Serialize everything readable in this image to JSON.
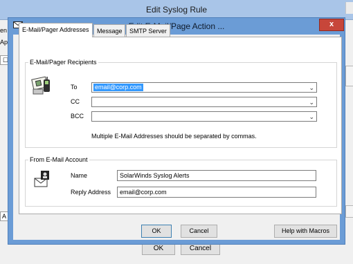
{
  "background_window": {
    "title": "Edit Syslog Rule",
    "left_fragments": [
      "en",
      "Ap"
    ],
    "left_tab_fragment": "A",
    "footer_buttons": {
      "ok": "OK",
      "cancel": "Cancel"
    }
  },
  "dialog": {
    "title": "Edit E-Mail/Page Action ...",
    "close_glyph": "x",
    "tabs": [
      {
        "label": "E-Mail/Pager Addresses",
        "active": true
      },
      {
        "label": "Message",
        "active": false
      },
      {
        "label": "SMTP Server",
        "active": false
      }
    ],
    "recipients": {
      "group_label": "E-Mail/Pager Recipients",
      "icon": "contact-card-icon",
      "to_label": "To",
      "to_value": "email@corp.com",
      "cc_label": "CC",
      "cc_value": "",
      "bcc_label": "BCC",
      "bcc_value": "",
      "note": "Multiple E-Mail Addresses should be separated by commas."
    },
    "account": {
      "group_label": "From E-Mail Account",
      "icon": "mail-account-icon",
      "name_label": "Name",
      "name_value": "SolarWinds Syslog Alerts",
      "reply_label": "Reply Address",
      "reply_value": "email@corp.com"
    },
    "buttons": {
      "ok": "OK",
      "cancel": "Cancel",
      "help": "Help with Macros"
    }
  },
  "colors": {
    "dialog_frame": "#6b9cd6",
    "close_button": "#c7463a",
    "selection": "#3399ff"
  }
}
